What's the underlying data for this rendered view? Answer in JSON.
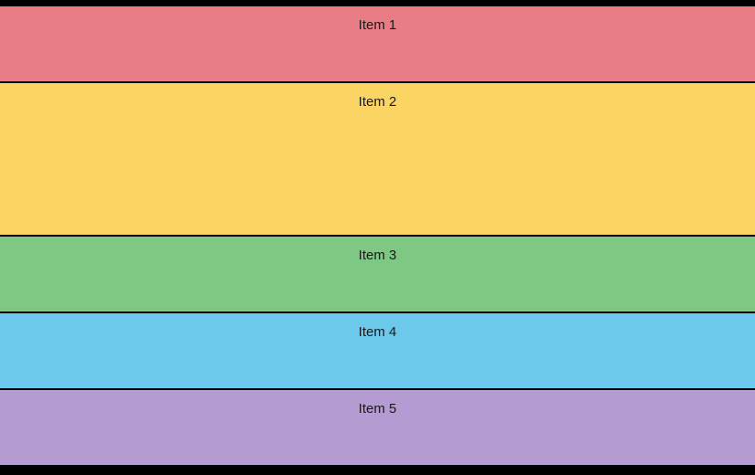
{
  "rows": [
    {
      "label": "Item 1",
      "color": "#e97d86"
    },
    {
      "label": "Item 2",
      "color": "#fad564"
    },
    {
      "label": "Item 3",
      "color": "#7ec883"
    },
    {
      "label": "Item 4",
      "color": "#6cc9ec"
    },
    {
      "label": "Item 5",
      "color": "#b49bd2"
    }
  ]
}
